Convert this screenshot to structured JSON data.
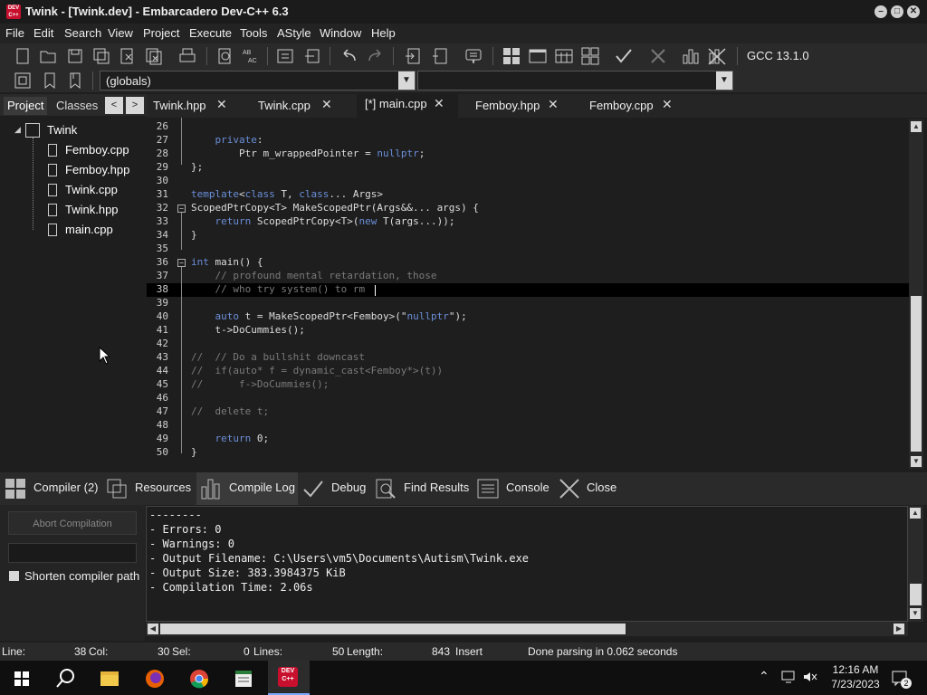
{
  "window": {
    "title": "Twink - [Twink.dev] - Embarcadero Dev-C++ 6.3",
    "app_icon_text": "DEV C++",
    "minimize": "–",
    "maximize": "□",
    "close": "✕"
  },
  "menu": [
    "File",
    "Edit",
    "Search",
    "View",
    "Project",
    "Execute",
    "Tools",
    "AStyle",
    "Window",
    "Help"
  ],
  "toolbar": {
    "compiler": "GCC 13.1.0",
    "scope_select": "(globals)",
    "function_select": ""
  },
  "left_panel": {
    "tabs": [
      "Project",
      "Classes"
    ],
    "nav_prev": "<",
    "nav_next": ">",
    "project_name": "Twink",
    "files": [
      "Femboy.cpp",
      "Femboy.hpp",
      "Twink.cpp",
      "Twink.hpp",
      "main.cpp"
    ]
  },
  "editor_tabs": [
    {
      "label": "Twink.hpp"
    },
    {
      "label": "Twink.cpp"
    },
    {
      "label": "[*] main.cpp"
    },
    {
      "label": "Femboy.hpp"
    },
    {
      "label": "Femboy.cpp"
    }
  ],
  "code_lines": [
    {
      "n": "26",
      "text": ""
    },
    {
      "n": "27",
      "text": "    private:"
    },
    {
      "n": "28",
      "text": "        Ptr m_wrappedPointer = nullptr;"
    },
    {
      "n": "29",
      "text": "};"
    },
    {
      "n": "30",
      "text": ""
    },
    {
      "n": "31",
      "text": "template<class T, class... Args>"
    },
    {
      "n": "32",
      "text": "ScopedPtrCopy<T> MakeScopedPtr(Args&&... args) {"
    },
    {
      "n": "33",
      "text": "    return ScopedPtrCopy<T>(new T(args...));"
    },
    {
      "n": "34",
      "text": "}"
    },
    {
      "n": "35",
      "text": ""
    },
    {
      "n": "36",
      "text": "int main() {"
    },
    {
      "n": "37",
      "text": "    // profound mental retardation, those"
    },
    {
      "n": "38",
      "text": "    // who try system() to rm"
    },
    {
      "n": "39",
      "text": ""
    },
    {
      "n": "40",
      "text": "    auto t = MakeScopedPtr<Femboy>(\"nullptr\");"
    },
    {
      "n": "41",
      "text": "    t->DoCummies();"
    },
    {
      "n": "42",
      "text": ""
    },
    {
      "n": "43",
      "text": "//  // Do a bullshit downcast"
    },
    {
      "n": "44",
      "text": "//  if(auto* f = dynamic_cast<Femboy*>(t))"
    },
    {
      "n": "45",
      "text": "//      f->DoCummies();"
    },
    {
      "n": "46",
      "text": ""
    },
    {
      "n": "47",
      "text": "//  delete t;"
    },
    {
      "n": "48",
      "text": ""
    },
    {
      "n": "49",
      "text": "    return 0;"
    },
    {
      "n": "50",
      "text": "}"
    }
  ],
  "bottom_tabs": [
    {
      "label": "Compiler (2)"
    },
    {
      "label": "Resources"
    },
    {
      "label": "Compile Log"
    },
    {
      "label": "Debug"
    },
    {
      "label": "Find Results"
    },
    {
      "label": "Console"
    },
    {
      "label": "Close"
    }
  ],
  "compile_panel": {
    "abort_label": "Abort Compilation",
    "shorten_label": "Shorten compiler path",
    "log_lines": [
      "--------",
      "- Errors: 0",
      "- Warnings: 0",
      "- Output Filename: C:\\Users\\vm5\\Documents\\Autism\\Twink.exe",
      "- Output Size: 383.3984375 KiB",
      "- Compilation Time: 2.06s"
    ]
  },
  "status": {
    "line_label": "Line:",
    "line_value": "38",
    "col_label": "Col:",
    "col_value": "30",
    "sel_label": "Sel:",
    "sel_value": "0",
    "lines_label": "Lines:",
    "lines_value": "50",
    "length_label": "Length:",
    "length_value": "843",
    "mode": "Insert",
    "message": "Done parsing in 0.062 seconds"
  },
  "taskbar": {
    "time": "12:16 AM",
    "date": "7/23/2023",
    "notification_count": "2"
  },
  "colors": {
    "keyword": "#6a8ed8",
    "comment": "#7a7a7a",
    "background": "#1e1e1e",
    "app_icon": "#c8102e"
  }
}
